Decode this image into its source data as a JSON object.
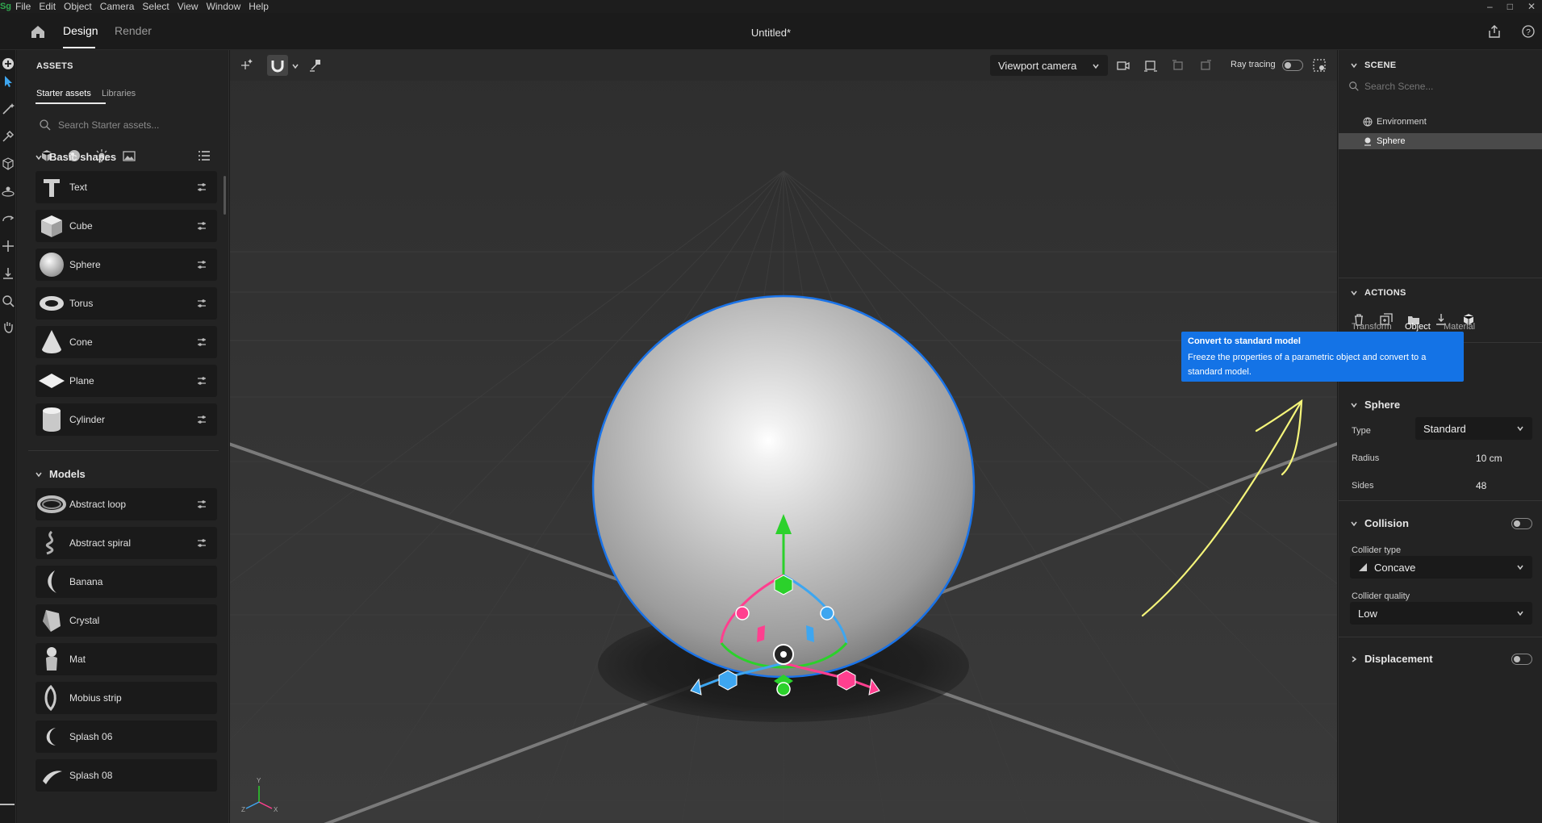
{
  "menubar": {
    "logo": "Sg",
    "items": [
      "File",
      "Edit",
      "Object",
      "Camera",
      "Select",
      "View",
      "Window",
      "Help"
    ],
    "window_controls": [
      "–",
      "□",
      "✕"
    ]
  },
  "topbar": {
    "tabs": [
      "Design",
      "Render"
    ],
    "active_tab": "Design",
    "document_title": "Untitled*"
  },
  "assets": {
    "title": "ASSETS",
    "subtabs": [
      "Starter assets",
      "Libraries"
    ],
    "search_placeholder": "Search Starter assets...",
    "basic_shapes_title": "Basic shapes",
    "basic_shapes": [
      "Text",
      "Cube",
      "Sphere",
      "Torus",
      "Cone",
      "Plane",
      "Cylinder"
    ],
    "models_title": "Models",
    "models": [
      "Abstract loop",
      "Abstract spiral",
      "Banana",
      "Crystal",
      "Mat",
      "Mobius strip",
      "Splash 06",
      "Splash 08"
    ]
  },
  "viewport": {
    "camera_select": "Viewport camera",
    "ray_tracing_label": "Ray tracing",
    "ray_tracing_on": false,
    "axis_labels": {
      "x": "X",
      "y": "Y",
      "z": "Z"
    },
    "colors": {
      "selection": "#1a73e8",
      "gizmo_green": "#2bd12b",
      "gizmo_blue": "#3ea6f0",
      "gizmo_pink": "#ff3f8f",
      "annotation": "#f5f57a"
    }
  },
  "scene": {
    "title": "SCENE",
    "search_placeholder": "Search Scene...",
    "items": [
      "Environment",
      "Sphere"
    ],
    "selected": "Sphere"
  },
  "actions": {
    "title": "ACTIONS"
  },
  "tooltip": {
    "title": "Convert to standard model",
    "body": "Freeze the properties of a parametric object and convert to a standard model."
  },
  "properties": {
    "tabs": [
      "Transform",
      "Object",
      "Material"
    ],
    "active_tab": "Object",
    "section_title": "Sphere",
    "type_label": "Type",
    "type_value": "Standard",
    "radius_label": "Radius",
    "radius_value": "10 cm",
    "sides_label": "Sides",
    "sides_value": "48",
    "collision_title": "Collision",
    "collider_type_label": "Collider type",
    "collider_type_value": "Concave",
    "collider_quality_label": "Collider quality",
    "collider_quality_value": "Low",
    "displacement_title": "Displacement"
  }
}
